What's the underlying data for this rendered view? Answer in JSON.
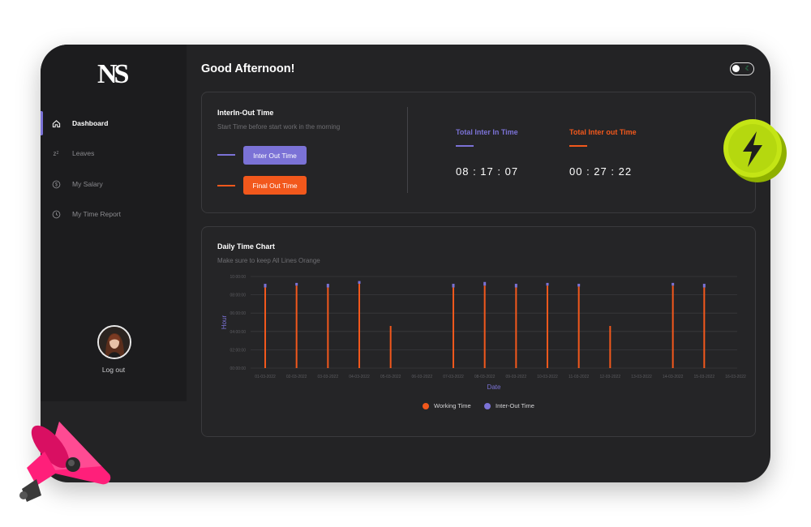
{
  "app": {
    "logo_text": "NS",
    "greeting": "Good Afternoon!"
  },
  "sidebar": {
    "items": [
      {
        "label": "Dashboard",
        "icon": "home-icon",
        "active": true
      },
      {
        "label": "Leaves",
        "icon": "sleep-icon",
        "active": false
      },
      {
        "label": "My Salary",
        "icon": "dollar-circle-icon",
        "active": false
      },
      {
        "label": "My Time Report",
        "icon": "clock-icon",
        "active": false
      }
    ],
    "logout_label": "Log out"
  },
  "time_card": {
    "title": "InterIn-Out Time",
    "subtitle": "Start Time before start work in the morning",
    "inter_out_button": "Inter Out Time",
    "final_out_button": "Final Out Time",
    "stats": [
      {
        "label": "Total Inter In Time",
        "value": "08 : 17 : 07",
        "color": "#7b72d6"
      },
      {
        "label": "Total Inter out Time",
        "value": "00 : 27 : 22",
        "color": "#f2581c"
      }
    ]
  },
  "chart_card": {
    "title": "Daily Time Chart",
    "subtitle": "Make sure to keep All Lines Orange"
  },
  "colors": {
    "purple": "#7b72d6",
    "orange": "#f2581c",
    "background": "#232325"
  },
  "chart_data": {
    "type": "bar",
    "xlabel": "Date",
    "ylabel": "Hour",
    "y_tick_labels": [
      "00:00:00",
      "02:00:00",
      "04:00:00",
      "06:00:00",
      "08:00:00",
      "10:00:00"
    ],
    "ylim": [
      0,
      10
    ],
    "categories": [
      "01-03-2022",
      "02-03-2022",
      "03-03-2022",
      "04-03-2022",
      "05-03-2022",
      "06-03-2022",
      "07-03-2022",
      "08-03-2022",
      "09-03-2022",
      "10-03-2022",
      "11-03-2022",
      "12-03-2022",
      "13-03-2022",
      "14-03-2022",
      "15-03-2022",
      "16-03-2022"
    ],
    "series": [
      {
        "name": "Working Time",
        "color": "#f2581c",
        "values": [
          8.8,
          9.0,
          8.8,
          9.2,
          4.6,
          0,
          8.8,
          9.0,
          8.8,
          9.0,
          8.9,
          4.6,
          0,
          9.0,
          8.8,
          0
        ]
      },
      {
        "name": "Inter-Out Time",
        "color": "#7b72d6",
        "values": [
          0.4,
          0.3,
          0.4,
          0.3,
          0,
          0,
          0.4,
          0.4,
          0.4,
          0.3,
          0.3,
          0,
          0,
          0.3,
          0.4,
          0
        ]
      }
    ],
    "legend": "bottom-center",
    "grid": true
  }
}
